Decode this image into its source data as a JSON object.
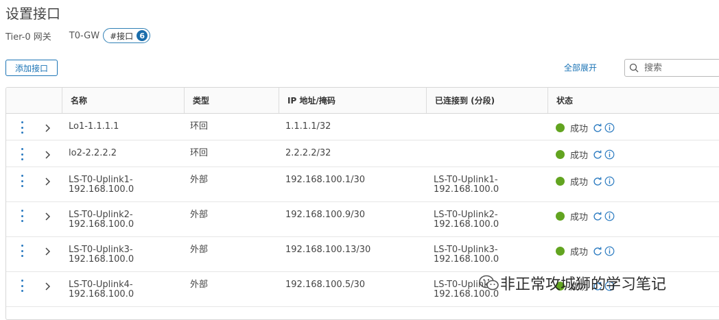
{
  "page": {
    "title": "设置接口"
  },
  "breadcrumb": {
    "gateway_type": "Tier-0 网关",
    "gateway_name": "T0-GW",
    "tag_label": "#接口",
    "tag_count": "6"
  },
  "toolbar": {
    "add_label": "添加接口",
    "expand_all_label": "全部展开",
    "search_placeholder": "搜索"
  },
  "table": {
    "headers": [
      "名称",
      "类型",
      "IP 地址/掩码",
      "已连接到 (分段)",
      "状态"
    ],
    "rows": [
      {
        "name": "Lo1-1.1.1.1",
        "type": "环回",
        "ip": "1.1.1.1/32",
        "connected": "",
        "status": "成功"
      },
      {
        "name": "lo2-2.2.2.2",
        "type": "环回",
        "ip": "2.2.2.2/32",
        "connected": "",
        "status": "成功"
      },
      {
        "name": "LS-T0-Uplink1-\n192.168.100.0",
        "type": "外部",
        "ip": "192.168.100.1/30",
        "connected": "LS-T0-Uplink1-\n192.168.100.0",
        "status": "成功"
      },
      {
        "name": "LS-T0-Uplink2-\n192.168.100.0",
        "type": "外部",
        "ip": "192.168.100.9/30",
        "connected": "LS-T0-Uplink2-\n192.168.100.0",
        "status": "成功"
      },
      {
        "name": "LS-T0-Uplink3-\n192.168.100.0",
        "type": "外部",
        "ip": "192.168.100.13/30",
        "connected": "LS-T0-Uplink3-\n192.168.100.0",
        "status": "成功"
      },
      {
        "name": "LS-T0-Uplink4-\n192.168.100.0",
        "type": "外部",
        "ip": "192.168.100.5/30",
        "connected": "LS-T0-Uplink4-\n192.168.100.0",
        "status": "成功"
      }
    ]
  },
  "watermark": {
    "text": "非正常攻城狮的学习笔记"
  },
  "colors": {
    "accent": "#1a73b5",
    "success": "#62a420",
    "tag_badge": "#1a6dab"
  },
  "icons": {
    "row_menu": "kebab-icon",
    "row_expand": "chevron-right-icon",
    "refresh": "refresh-icon",
    "info": "info-icon",
    "search": "search-icon",
    "watermark": "wechat-icon"
  }
}
